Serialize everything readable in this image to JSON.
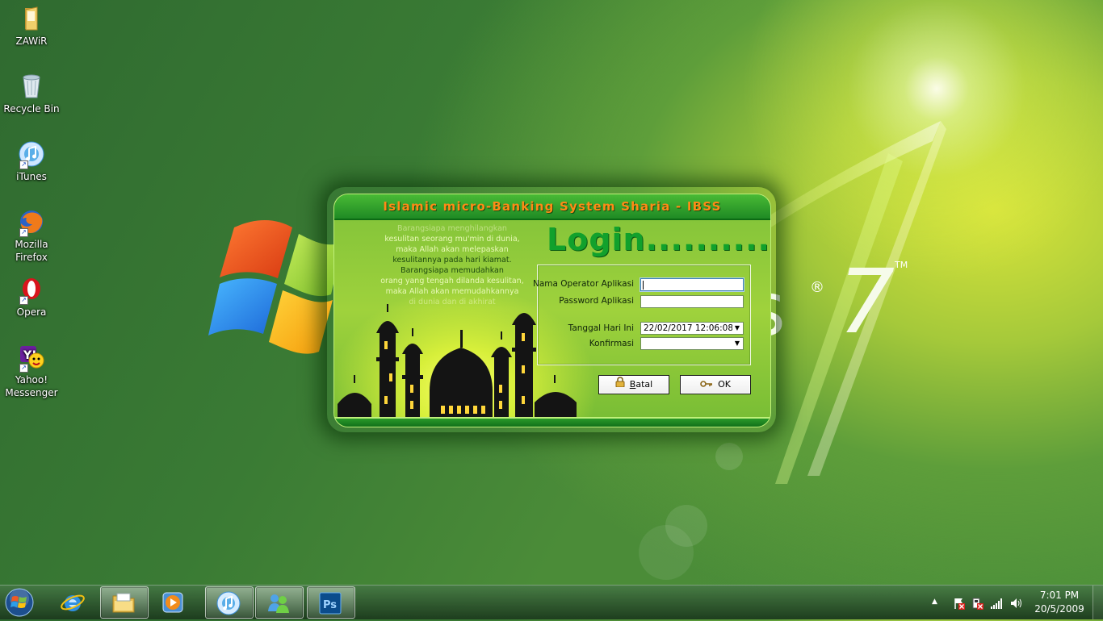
{
  "desktop": {
    "icons": [
      {
        "label": "ZAWiR",
        "icon": "folder-icon"
      },
      {
        "label": "Recycle Bin",
        "icon": "recycle-bin-icon"
      },
      {
        "label": "iTunes",
        "icon": "itunes-icon"
      },
      {
        "label": "Mozilla Firefox",
        "icon": "firefox-icon"
      },
      {
        "label": "Opera",
        "icon": "opera-icon"
      },
      {
        "label": "Yahoo! Messenger",
        "icon": "yahoo-messenger-icon"
      }
    ]
  },
  "wallpaper": {
    "brand_text": "s",
    "version": "7",
    "registered": "®",
    "trademark": "TM"
  },
  "login_window": {
    "title": "Islamic micro-Banking System Sharia - IBSS",
    "heading": "Login..........",
    "quote_lines": [
      "Barangsiapa menghilangkan",
      "kesulitan seorang mu'min di dunia,",
      "maka Allah akan melepaskan",
      "kesulitannya pada hari kiamat.",
      "Barangsiapa memudahkan",
      "orang yang tengah dilanda kesulitan,",
      "maka Allah akan memudahkannya",
      "di dunia dan di akhirat"
    ],
    "fields": {
      "operator_label": "Nama Operator Aplikasi",
      "operator_value": "",
      "password_label": "Password Aplikasi",
      "password_value": "",
      "date_label": "Tanggal Hari Ini",
      "date_value": "22/02/2017 12:06:08",
      "confirm_label": "Konfirmasi",
      "confirm_value": ""
    },
    "buttons": {
      "cancel_label": "Batal",
      "cancel_hotkey": "B",
      "cancel_rest": "atal",
      "ok_label": "OK"
    }
  },
  "taskbar": {
    "pinned": [
      {
        "name": "internet-explorer-icon",
        "active": false
      },
      {
        "name": "windows-explorer-icon",
        "active": true
      },
      {
        "name": "media-player-icon",
        "active": false
      },
      {
        "name": "itunes-icon",
        "active": true
      },
      {
        "name": "messenger-icon",
        "active": true
      },
      {
        "name": "photoshop-icon",
        "active": true
      }
    ],
    "photoshop_text": "Ps",
    "clock_time": "7:01 PM",
    "clock_date": "20/5/2009"
  },
  "colors": {
    "accent_orange": "#ff8a16",
    "login_green": "#11a12c",
    "title_green": "#1f8a24"
  }
}
